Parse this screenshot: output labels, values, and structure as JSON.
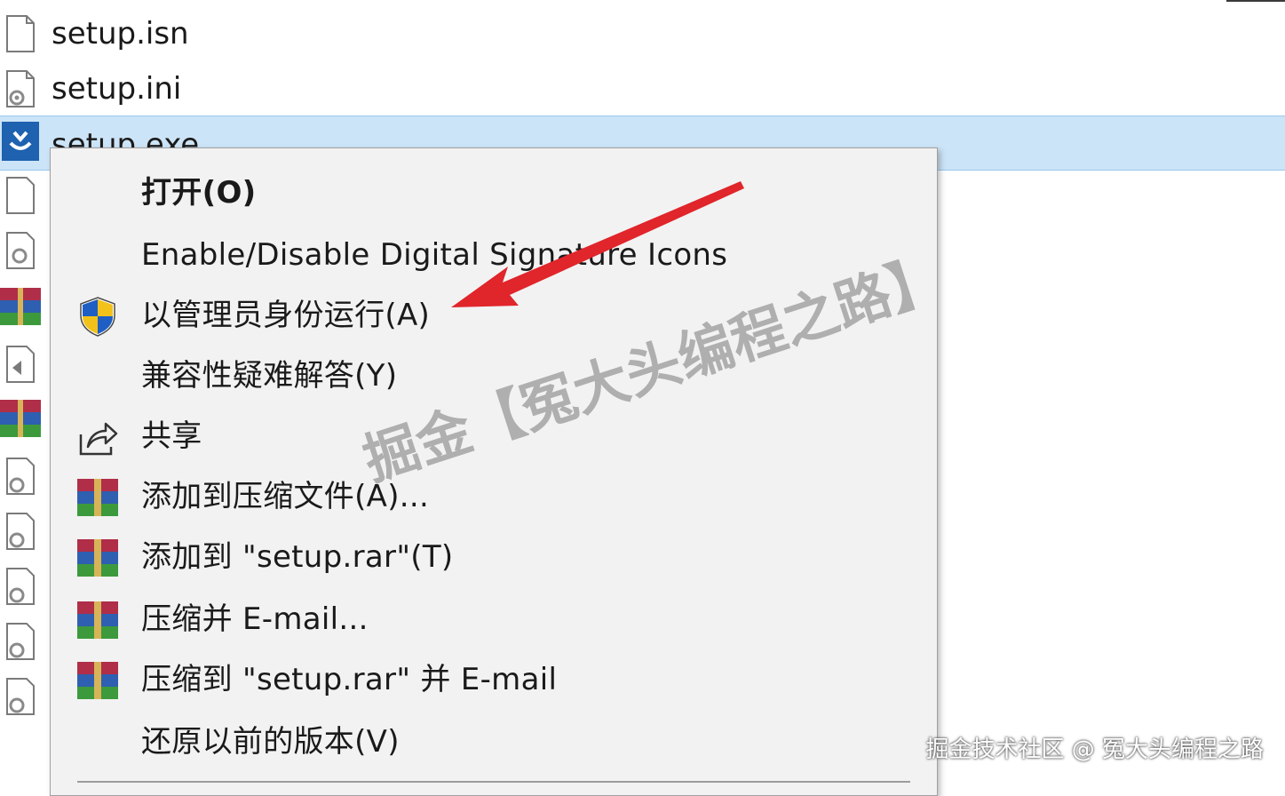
{
  "files": [
    {
      "name": "setup.isn",
      "icon": "blank-file-icon"
    },
    {
      "name": "setup.ini",
      "icon": "settings-file-icon"
    },
    {
      "name": "setup.exe",
      "icon": "installer-icon",
      "selected": true
    }
  ],
  "context_menu": {
    "items": [
      {
        "id": "open",
        "label": "打开(O)",
        "icon": "",
        "bold": true
      },
      {
        "id": "signature-icons",
        "label": "Enable/Disable Digital Signature Icons",
        "icon": ""
      },
      {
        "id": "run-as-admin",
        "label": "以管理员身份运行(A)",
        "icon": "uac-shield-icon"
      },
      {
        "id": "compat-troubleshoot",
        "label": "兼容性疑难解答(Y)",
        "icon": ""
      },
      {
        "id": "share",
        "label": "共享",
        "icon": "share-icon"
      },
      {
        "id": "add-to-archive",
        "label": "添加到压缩文件(A)...",
        "icon": "winrar-icon"
      },
      {
        "id": "add-to-setup-rar",
        "label": "添加到 \"setup.rar\"(T)",
        "icon": "winrar-icon"
      },
      {
        "id": "compress-email",
        "label": "压缩并 E-mail...",
        "icon": "winrar-icon"
      },
      {
        "id": "compress-rar-email",
        "label": "压缩到 \"setup.rar\" 并 E-mail",
        "icon": "winrar-icon"
      },
      {
        "id": "restore-previous",
        "label": "还原以前的版本(V)",
        "icon": ""
      }
    ]
  },
  "watermark": "掘金【冤大头编程之路】",
  "credit": "掘金技术社区 @ 冤大头编程之路",
  "colors": {
    "selection": "#cce4f7",
    "menu_bg": "#f2f2f2",
    "arrow": "#e0252b"
  }
}
